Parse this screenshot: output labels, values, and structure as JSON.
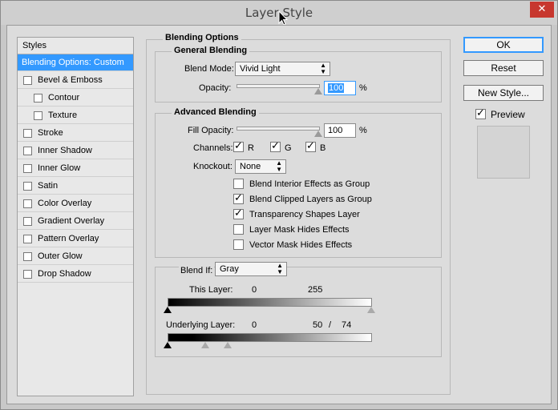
{
  "window": {
    "title": "Layer Style",
    "close_glyph": "✕"
  },
  "styles_panel": {
    "header": "Styles",
    "items": [
      {
        "label": "Blending Options: Custom",
        "checkbox": false,
        "checked": false,
        "selected": true,
        "indent": false
      },
      {
        "label": "Bevel & Emboss",
        "checkbox": true,
        "checked": false,
        "selected": false,
        "indent": false
      },
      {
        "label": "Contour",
        "checkbox": true,
        "checked": false,
        "selected": false,
        "indent": true
      },
      {
        "label": "Texture",
        "checkbox": true,
        "checked": false,
        "selected": false,
        "indent": true
      },
      {
        "label": "Stroke",
        "checkbox": true,
        "checked": false,
        "selected": false,
        "indent": false
      },
      {
        "label": "Inner Shadow",
        "checkbox": true,
        "checked": false,
        "selected": false,
        "indent": false
      },
      {
        "label": "Inner Glow",
        "checkbox": true,
        "checked": false,
        "selected": false,
        "indent": false
      },
      {
        "label": "Satin",
        "checkbox": true,
        "checked": false,
        "selected": false,
        "indent": false
      },
      {
        "label": "Color Overlay",
        "checkbox": true,
        "checked": false,
        "selected": false,
        "indent": false
      },
      {
        "label": "Gradient Overlay",
        "checkbox": true,
        "checked": false,
        "selected": false,
        "indent": false
      },
      {
        "label": "Pattern Overlay",
        "checkbox": true,
        "checked": false,
        "selected": false,
        "indent": false
      },
      {
        "label": "Outer Glow",
        "checkbox": true,
        "checked": false,
        "selected": false,
        "indent": false
      },
      {
        "label": "Drop Shadow",
        "checkbox": true,
        "checked": false,
        "selected": false,
        "indent": false
      }
    ]
  },
  "blending_options": {
    "title": "Blending Options",
    "general": {
      "title": "General Blending",
      "blend_mode_label": "Blend Mode:",
      "blend_mode_value": "Vivid Light",
      "opacity_label": "Opacity:",
      "opacity_value": "100",
      "opacity_unit": "%",
      "opacity_slider_fraction": 1.0
    },
    "advanced": {
      "title": "Advanced Blending",
      "fill_opacity_label": "Fill Opacity:",
      "fill_opacity_value": "100",
      "fill_opacity_unit": "%",
      "fill_opacity_slider_fraction": 1.0,
      "channels_label": "Channels:",
      "channels": [
        {
          "label": "R",
          "checked": true
        },
        {
          "label": "G",
          "checked": true
        },
        {
          "label": "B",
          "checked": true
        }
      ],
      "knockout_label": "Knockout:",
      "knockout_value": "None",
      "options": [
        {
          "label": "Blend Interior Effects as Group",
          "checked": false
        },
        {
          "label": "Blend Clipped Layers as Group",
          "checked": true
        },
        {
          "label": "Transparency Shapes Layer",
          "checked": true
        },
        {
          "label": "Layer Mask Hides Effects",
          "checked": false
        },
        {
          "label": "Vector Mask Hides Effects",
          "checked": false
        }
      ]
    },
    "blend_if": {
      "label": "Blend If:",
      "value": "Gray",
      "this_layer_label": "This Layer:",
      "this_layer_low": "0",
      "this_layer_high": "255",
      "underlying_label": "Underlying Layer:",
      "underlying_low": "0",
      "underlying_high_a": "50",
      "underlying_sep": "/",
      "underlying_high_b": "74"
    }
  },
  "buttons": {
    "ok": "OK",
    "reset": "Reset",
    "new_style": "New Style...",
    "preview_label": "Preview",
    "preview_checked": true
  }
}
